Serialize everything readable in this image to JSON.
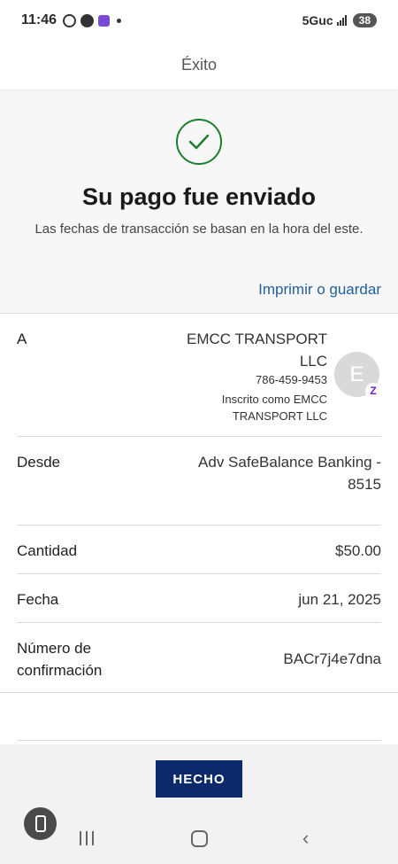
{
  "status_bar": {
    "time": "11:46",
    "network": "5Guc",
    "battery": "38",
    "app_icons": [
      "whatsapp-icon",
      "messenger-icon",
      "app-notification-icon"
    ]
  },
  "header": {
    "title": "Éxito"
  },
  "success": {
    "title": "Su pago fue enviado",
    "note": "Las fechas de transacción se basan en la hora del este.",
    "print_link": "Imprimir o guardar",
    "check_color": "#1a7f2e"
  },
  "details": {
    "to": {
      "label": "A",
      "name": "EMCC TRANSPORT LLC",
      "phone": "786-459-9453",
      "enrolled": "Inscrito como EMCC TRANSPORT LLC",
      "avatar_letter": "E",
      "badge": "Z"
    },
    "from": {
      "label": "Desde",
      "value": "Adv SafeBalance Banking - 8515"
    },
    "amount": {
      "label": "Cantidad",
      "value": "$50.00"
    },
    "date": {
      "label": "Fecha",
      "value": "jun 21, 2025"
    },
    "confirmation": {
      "label": "Número de confirmación",
      "value": "BACr7j4e7dna"
    }
  },
  "actions": {
    "done_label": "HECHO",
    "done_color": "#0c2a6b"
  },
  "nav": {
    "recents": "recents-icon",
    "home": "home-icon",
    "back": "back-icon"
  }
}
